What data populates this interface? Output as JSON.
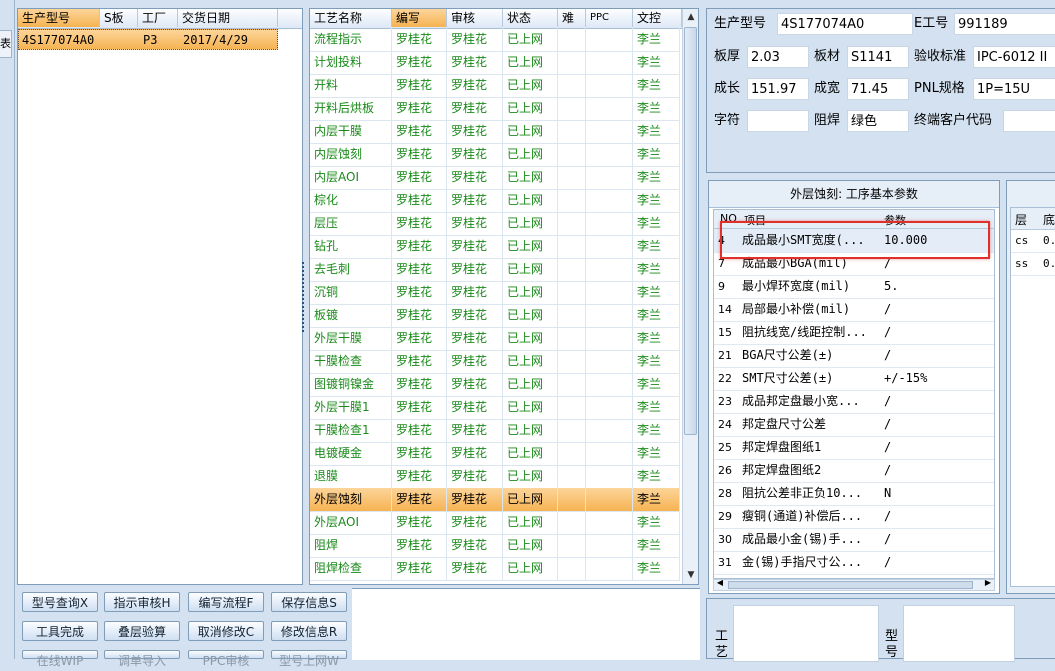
{
  "left_panel": {
    "headers": [
      "生产型号",
      "S板",
      "工厂",
      "交货日期"
    ],
    "row": {
      "model": "4S177074A0",
      "s": "",
      "factory": "P3",
      "date": "2017/4/29"
    }
  },
  "process_table": {
    "headers": [
      "工艺名称",
      "编写",
      "审核",
      "状态",
      "难",
      "PPC",
      "文控"
    ],
    "rows": [
      {
        "name": "流程指示",
        "writer": "罗桂花",
        "reviewer": "罗桂花",
        "status": "已上网",
        "doc": "李兰"
      },
      {
        "name": "计划投料",
        "writer": "罗桂花",
        "reviewer": "罗桂花",
        "status": "已上网",
        "doc": "李兰"
      },
      {
        "name": "开料",
        "writer": "罗桂花",
        "reviewer": "罗桂花",
        "status": "已上网",
        "doc": "李兰"
      },
      {
        "name": "开料后烘板",
        "writer": "罗桂花",
        "reviewer": "罗桂花",
        "status": "已上网",
        "doc": "李兰"
      },
      {
        "name": "内层干膜",
        "writer": "罗桂花",
        "reviewer": "罗桂花",
        "status": "已上网",
        "doc": "李兰"
      },
      {
        "name": "内层蚀刻",
        "writer": "罗桂花",
        "reviewer": "罗桂花",
        "status": "已上网",
        "doc": "李兰"
      },
      {
        "name": "内层AOI",
        "writer": "罗桂花",
        "reviewer": "罗桂花",
        "status": "已上网",
        "doc": "李兰"
      },
      {
        "name": "棕化",
        "writer": "罗桂花",
        "reviewer": "罗桂花",
        "status": "已上网",
        "doc": "李兰"
      },
      {
        "name": "层压",
        "writer": "罗桂花",
        "reviewer": "罗桂花",
        "status": "已上网",
        "doc": "李兰"
      },
      {
        "name": "钻孔",
        "writer": "罗桂花",
        "reviewer": "罗桂花",
        "status": "已上网",
        "doc": "李兰"
      },
      {
        "name": "去毛刺",
        "writer": "罗桂花",
        "reviewer": "罗桂花",
        "status": "已上网",
        "doc": "李兰"
      },
      {
        "name": "沉铜",
        "writer": "罗桂花",
        "reviewer": "罗桂花",
        "status": "已上网",
        "doc": "李兰"
      },
      {
        "name": "板镀",
        "writer": "罗桂花",
        "reviewer": "罗桂花",
        "status": "已上网",
        "doc": "李兰"
      },
      {
        "name": "外层干膜",
        "writer": "罗桂花",
        "reviewer": "罗桂花",
        "status": "已上网",
        "doc": "李兰"
      },
      {
        "name": "干膜检查",
        "writer": "罗桂花",
        "reviewer": "罗桂花",
        "status": "已上网",
        "doc": "李兰"
      },
      {
        "name": "图镀铜镍金",
        "writer": "罗桂花",
        "reviewer": "罗桂花",
        "status": "已上网",
        "doc": "李兰"
      },
      {
        "name": "外层干膜1",
        "writer": "罗桂花",
        "reviewer": "罗桂花",
        "status": "已上网",
        "doc": "李兰"
      },
      {
        "name": "干膜检查1",
        "writer": "罗桂花",
        "reviewer": "罗桂花",
        "status": "已上网",
        "doc": "李兰"
      },
      {
        "name": "电镀硬金",
        "writer": "罗桂花",
        "reviewer": "罗桂花",
        "status": "已上网",
        "doc": "李兰"
      },
      {
        "name": "退膜",
        "writer": "罗桂花",
        "reviewer": "罗桂花",
        "status": "已上网",
        "doc": "李兰"
      },
      {
        "name": "外层蚀刻",
        "writer": "罗桂花",
        "reviewer": "罗桂花",
        "status": "已上网",
        "doc": "李兰"
      },
      {
        "name": "外层AOI",
        "writer": "罗桂花",
        "reviewer": "罗桂花",
        "status": "已上网",
        "doc": "李兰"
      },
      {
        "name": "阻焊",
        "writer": "罗桂花",
        "reviewer": "罗桂花",
        "status": "已上网",
        "doc": "李兰"
      },
      {
        "name": "阻焊检查",
        "writer": "罗桂花",
        "reviewer": "罗桂花",
        "status": "已上网",
        "doc": "李兰"
      }
    ]
  },
  "buttons": {
    "row1": [
      "型号查询X",
      "指示审核H",
      "编写流程F",
      "保存信息S"
    ],
    "row2": [
      "工具完成",
      "叠层验算",
      "取消修改C",
      "修改信息R"
    ],
    "row3": [
      "在线WIP",
      "调单导入",
      "PPC审核",
      "型号上网W"
    ]
  },
  "info": {
    "model_label": "生产型号",
    "model_value": "4S177074A0",
    "e_label": "E工号",
    "e_value": "991189",
    "thickness_label": "板厚",
    "thickness_value": "2.03",
    "material_label": "板材",
    "material_value": "S1141",
    "standard_label": "验收标准",
    "standard_value": "IPC-6012 II",
    "length_label": "成长",
    "length_value": "151.97",
    "width_label": "成宽",
    "width_value": "71.45",
    "pnl_label": "PNL规格",
    "pnl_value": "1P=15U",
    "char_label": "字符",
    "char_value": "",
    "mask_label": "阻焊",
    "mask_value": "绿色",
    "customer_label": "终端客户代码",
    "customer_value": ""
  },
  "param_panel": {
    "title": "外层蚀刻: 工序基本参数",
    "headers": [
      "NO",
      "项目",
      "参数"
    ],
    "rows": [
      {
        "no": "4",
        "item": "成品最小SMT宽度(...",
        "param": "10.000"
      },
      {
        "no": "7",
        "item": "成品最小BGA(mil)",
        "param": "/"
      },
      {
        "no": "9",
        "item": "最小焊环宽度(mil)",
        "param": "5."
      },
      {
        "no": "14",
        "item": "局部最小补偿(mil)",
        "param": "/"
      },
      {
        "no": "15",
        "item": "阻抗线宽/线距控制...",
        "param": "/"
      },
      {
        "no": "21",
        "item": "BGA尺寸公差(±)",
        "param": "/"
      },
      {
        "no": "22",
        "item": "SMT尺寸公差(±)",
        "param": "+/-15%"
      },
      {
        "no": "23",
        "item": "成品邦定盘最小宽...",
        "param": "/"
      },
      {
        "no": "24",
        "item": "邦定盘尺寸公差",
        "param": "/"
      },
      {
        "no": "25",
        "item": "邦定焊盘图纸1",
        "param": "/"
      },
      {
        "no": "26",
        "item": "邦定焊盘图纸2",
        "param": "/"
      },
      {
        "no": "28",
        "item": "阻抗公差非正负10...",
        "param": "N"
      },
      {
        "no": "29",
        "item": "瘦铜(通道)补偿后...",
        "param": "/"
      },
      {
        "no": "30",
        "item": "成品最小金(锡)手...",
        "param": "/"
      },
      {
        "no": "31",
        "item": "金(锡)手指尺寸公...",
        "param": "/"
      }
    ]
  },
  "layer_panel": {
    "headers": [
      "层",
      "底"
    ],
    "rows": [
      {
        "layer": "cs",
        "val": "0."
      },
      {
        "layer": "ss",
        "val": "0."
      }
    ]
  },
  "bottom_labels": {
    "tool": "工艺",
    "model": "型号"
  },
  "side_tab": "表"
}
